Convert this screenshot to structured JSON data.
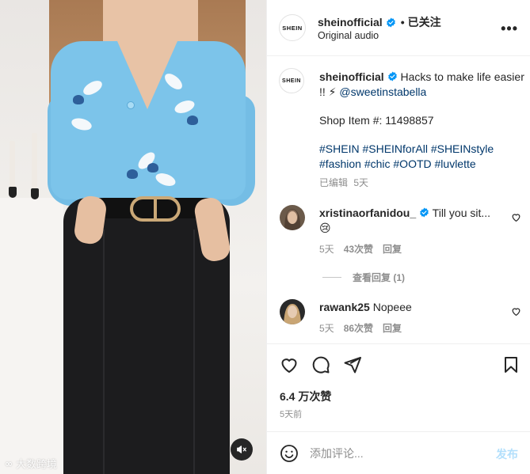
{
  "post": {
    "media_alt": "Video: woman in blue floral cardigan and black pants",
    "mute_icon": "speaker-muted-icon",
    "watermark": "大数跨境"
  },
  "header": {
    "username": "sheinofficial",
    "avatar_text": "SHEIN",
    "separator": "•",
    "follow_status": "已关注",
    "subtitle": "Original audio",
    "more_icon": "•••"
  },
  "caption": {
    "avatar_text": "SHEIN",
    "username": "sheinofficial",
    "line1": "Hacks to make life easier !! ⚡",
    "mention": "@sweetinstabella",
    "shop_item": "Shop Item #: 11498857",
    "hashtags": "#SHEIN #SHEINforAll #SHEINstyle #fashion #chic #OOTD #luvlette",
    "edited": "已编辑",
    "time": "5天"
  },
  "comments": [
    {
      "username": "xristinaorfanidou_",
      "verified": true,
      "text": "Till you sit...😢",
      "time": "5天",
      "likes": "43次赞",
      "reply": "回复",
      "view_replies": "查看回复 (1)"
    },
    {
      "username": "rawank25",
      "verified": false,
      "text": "Nopeee",
      "time": "5天",
      "likes": "86次赞",
      "reply": "回复"
    }
  ],
  "actions": {
    "like_icon": "heart-icon",
    "comment_icon": "comment-bubble-icon",
    "share_icon": "paper-plane-icon",
    "save_icon": "bookmark-icon",
    "likes_count": "6.4 万次赞",
    "posted_ago": "5天前"
  },
  "composer": {
    "emoji_icon": "smiley-icon",
    "placeholder": "添加评论...",
    "post_label": "发布"
  },
  "colors": {
    "verified": "#0095f6",
    "link": "#00376b",
    "muted": "#8e8e8e",
    "post_disabled": "#b2dffc"
  }
}
